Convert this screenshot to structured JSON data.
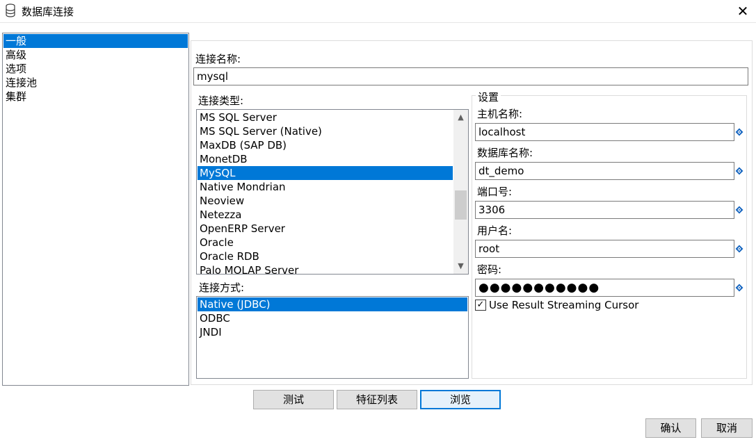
{
  "window": {
    "title": "数据库连接",
    "close_glyph": "✕"
  },
  "nav": {
    "items": [
      "一般",
      "高级",
      "选项",
      "连接池",
      "集群"
    ],
    "selected": 0
  },
  "general": {
    "conn_name_label": "连接名称:",
    "conn_name_value": "mysql",
    "conn_type_label": "连接类型:",
    "conn_types": [
      "MS SQL Server",
      "MS SQL Server (Native)",
      "MaxDB (SAP DB)",
      "MonetDB",
      "MySQL",
      "Native Mondrian",
      "Neoview",
      "Netezza",
      "OpenERP Server",
      "Oracle",
      "Oracle RDB",
      "Palo MOLAP Server"
    ],
    "conn_type_selected": 4,
    "access_label": "连接方式:",
    "access_types": [
      "Native (JDBC)",
      "ODBC",
      "JNDI"
    ],
    "access_selected": 0
  },
  "settings": {
    "legend": "设置",
    "fields": [
      {
        "label": "主机名称:",
        "value": "localhost"
      },
      {
        "label": "数据库名称:",
        "value": "dt_demo"
      },
      {
        "label": "端口号:",
        "value": "3306"
      },
      {
        "label": "用户名:",
        "value": "root"
      },
      {
        "label": "密码:",
        "value": "●●●●●●●●●●●"
      }
    ],
    "variable_icon": "diamond-variable-icon",
    "stream_checkbox": {
      "label": "Use Result Streaming Cursor",
      "checked": true
    }
  },
  "buttons": {
    "test": "测试",
    "features": "特征列表",
    "explore": "浏览",
    "ok": "确认",
    "cancel": "取消"
  },
  "colors": {
    "selection": "#0078d7",
    "var_icon": "#1565c0"
  }
}
